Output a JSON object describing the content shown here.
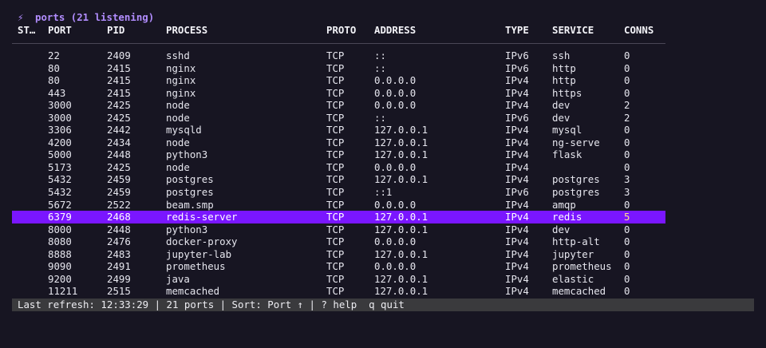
{
  "header": {
    "icon": "lightning-icon",
    "icon_glyph": "⚡",
    "title": "ports (21 listening)",
    "accent_color": "#b28dff"
  },
  "columns": {
    "st": "ST…",
    "port": "PORT",
    "pid": "PID",
    "process": "PROCESS",
    "proto": "PROTO",
    "address": "ADDRESS",
    "type": "TYPE",
    "service": "SERVICE",
    "conns": "CONNS"
  },
  "rows": [
    {
      "port": "22",
      "pid": "2409",
      "process": "sshd",
      "proto": "TCP",
      "address": "::",
      "type": "IPv6",
      "service": "ssh",
      "conns": "0"
    },
    {
      "port": "80",
      "pid": "2415",
      "process": "nginx",
      "proto": "TCP",
      "address": "::",
      "type": "IPv6",
      "service": "http",
      "conns": "0"
    },
    {
      "port": "80",
      "pid": "2415",
      "process": "nginx",
      "proto": "TCP",
      "address": "0.0.0.0",
      "type": "IPv4",
      "service": "http",
      "conns": "0"
    },
    {
      "port": "443",
      "pid": "2415",
      "process": "nginx",
      "proto": "TCP",
      "address": "0.0.0.0",
      "type": "IPv4",
      "service": "https",
      "conns": "0"
    },
    {
      "port": "3000",
      "pid": "2425",
      "process": "node",
      "proto": "TCP",
      "address": "0.0.0.0",
      "type": "IPv4",
      "service": "dev",
      "conns": "2"
    },
    {
      "port": "3000",
      "pid": "2425",
      "process": "node",
      "proto": "TCP",
      "address": "::",
      "type": "IPv6",
      "service": "dev",
      "conns": "2"
    },
    {
      "port": "3306",
      "pid": "2442",
      "process": "mysqld",
      "proto": "TCP",
      "address": "127.0.0.1",
      "type": "IPv4",
      "service": "mysql",
      "conns": "0"
    },
    {
      "port": "4200",
      "pid": "2434",
      "process": "node",
      "proto": "TCP",
      "address": "127.0.0.1",
      "type": "IPv4",
      "service": "ng-serve",
      "conns": "0"
    },
    {
      "port": "5000",
      "pid": "2448",
      "process": "python3",
      "proto": "TCP",
      "address": "127.0.0.1",
      "type": "IPv4",
      "service": "flask",
      "conns": "0"
    },
    {
      "port": "5173",
      "pid": "2425",
      "process": "node",
      "proto": "TCP",
      "address": "0.0.0.0",
      "type": "IPv4",
      "service": "",
      "conns": "0"
    },
    {
      "port": "5432",
      "pid": "2459",
      "process": "postgres",
      "proto": "TCP",
      "address": "127.0.0.1",
      "type": "IPv4",
      "service": "postgres",
      "conns": "3"
    },
    {
      "port": "5432",
      "pid": "2459",
      "process": "postgres",
      "proto": "TCP",
      "address": "::1",
      "type": "IPv6",
      "service": "postgres",
      "conns": "3"
    },
    {
      "port": "5672",
      "pid": "2522",
      "process": "beam.smp",
      "proto": "TCP",
      "address": "0.0.0.0",
      "type": "IPv4",
      "service": "amqp",
      "conns": "0"
    },
    {
      "port": "6379",
      "pid": "2468",
      "process": "redis-server",
      "proto": "TCP",
      "address": "127.0.0.1",
      "type": "IPv4",
      "service": "redis",
      "conns": "5",
      "selected": true
    },
    {
      "port": "8000",
      "pid": "2448",
      "process": "python3",
      "proto": "TCP",
      "address": "127.0.0.1",
      "type": "IPv4",
      "service": "dev",
      "conns": "0"
    },
    {
      "port": "8080",
      "pid": "2476",
      "process": "docker-proxy",
      "proto": "TCP",
      "address": "0.0.0.0",
      "type": "IPv4",
      "service": "http-alt",
      "conns": "0"
    },
    {
      "port": "8888",
      "pid": "2483",
      "process": "jupyter-lab",
      "proto": "TCP",
      "address": "127.0.0.1",
      "type": "IPv4",
      "service": "jupyter",
      "conns": "0"
    },
    {
      "port": "9090",
      "pid": "2491",
      "process": "prometheus",
      "proto": "TCP",
      "address": "0.0.0.0",
      "type": "IPv4",
      "service": "prometheus",
      "conns": "0"
    },
    {
      "port": "9200",
      "pid": "2499",
      "process": "java",
      "proto": "TCP",
      "address": "127.0.0.1",
      "type": "IPv4",
      "service": "elastic",
      "conns": "0"
    },
    {
      "port": "11211",
      "pid": "2515",
      "process": "memcached",
      "proto": "TCP",
      "address": "127.0.0.1",
      "type": "IPv4",
      "service": "memcached",
      "conns": "0"
    }
  ],
  "status_bar": {
    "text": "Last refresh: 12:33:29 | 21 ports | Sort: Port ↑ | ? help  q quit"
  },
  "colors": {
    "background": "#171522",
    "selection": "#7a16ff",
    "status_bar_bg": "#3a3a3d"
  }
}
